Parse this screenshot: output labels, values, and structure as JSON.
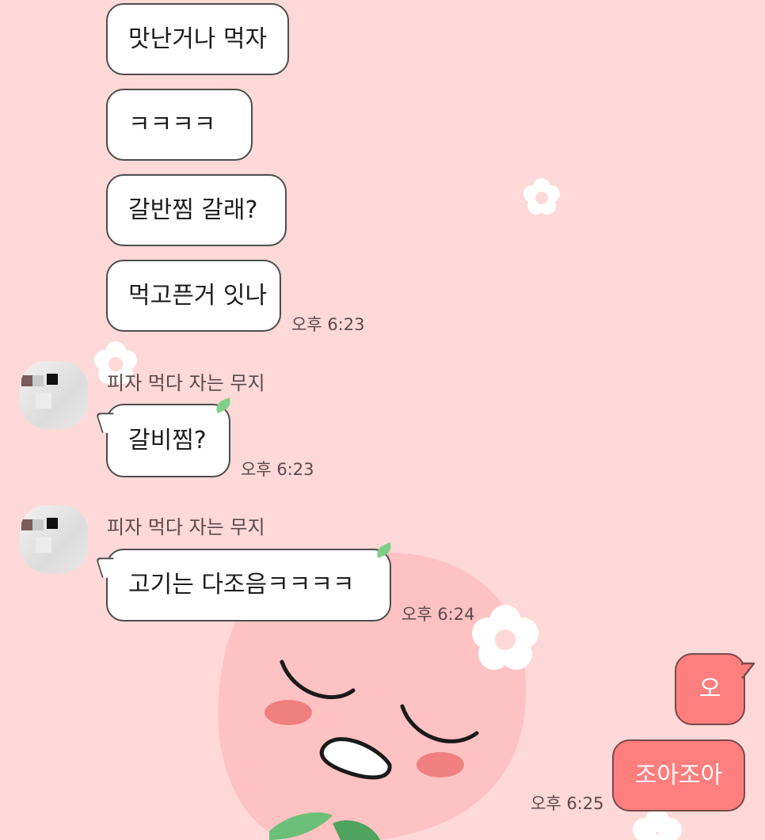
{
  "chat": {
    "messages": [
      {
        "text": "맛난거나 먹자"
      },
      {
        "text": "ㅋㅋㅋㅋ"
      },
      {
        "text": "갈반찜 갈래?"
      },
      {
        "text": "먹고픈거 잇나",
        "time": "오후 6:23"
      },
      {
        "sender": "피자 먹다 자는 무지",
        "text": "갈비찜?",
        "time": "오후 6:23"
      },
      {
        "sender": "피자 먹다 자는 무지",
        "text": "고기는 다조음ㅋㅋㅋㅋ",
        "time": "오후 6:24"
      },
      {
        "text": "오"
      },
      {
        "text": "조아조아",
        "time": "오후 6:25"
      }
    ]
  },
  "theme": {
    "background": "#ffd8d8",
    "my_bubble": "#ff7e7e",
    "other_bubble": "#ffffff",
    "character": "peach"
  }
}
